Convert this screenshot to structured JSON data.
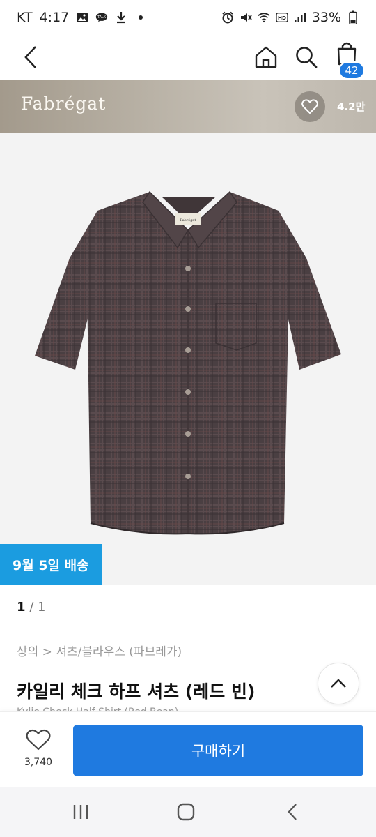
{
  "status": {
    "carrier": "KT",
    "time": "4:17",
    "notification_icons": [
      "gallery-icon",
      "talk-icon",
      "download-icon",
      "dot-icon"
    ],
    "system_icons": [
      "alarm-icon",
      "mute-icon",
      "wifi-icon",
      "hd-icon",
      "signal-icon"
    ],
    "battery": "33%"
  },
  "nav": {
    "cart_count": "42"
  },
  "brand": {
    "name": "Fabrégat",
    "likes": "4.2만"
  },
  "product": {
    "delivery_badge": "9월 5일 배송",
    "page_current": "1",
    "page_sep": " / ",
    "page_total": "1",
    "breadcrumb": "상의 > 셔츠/블라우스 (파브레가)",
    "title": "카일리 체크 하프 셔츠 (레드 빈)",
    "subtitle": "Kylie Check Half Shirt (Red Bean)",
    "shirt_label": "Fabrégat"
  },
  "buy_bar": {
    "wish_count": "3,740",
    "buy_label": "구매하기"
  },
  "colors": {
    "accent": "#1f7ae0",
    "delivery": "#1b9ce0",
    "shirt": "#4a3f42"
  }
}
